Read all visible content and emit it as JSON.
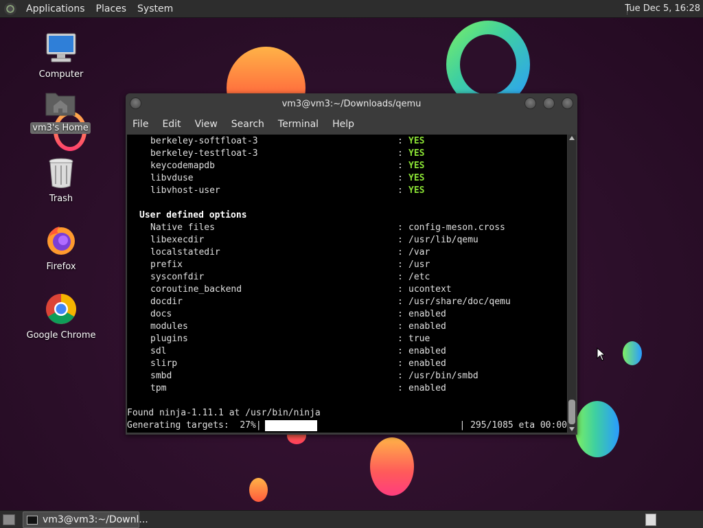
{
  "top_panel": {
    "menus": [
      "Applications",
      "Places",
      "System"
    ],
    "clock": "Tue Dec  5, 16:28"
  },
  "desktop_icons": [
    {
      "label": "Computer",
      "icon": "computer-icon"
    },
    {
      "label": "vm3's Home",
      "icon": "home-folder-icon",
      "selected": true
    },
    {
      "label": "Trash",
      "icon": "trash-icon"
    },
    {
      "label": "Firefox",
      "icon": "firefox-icon"
    },
    {
      "label": "Google Chrome",
      "icon": "chrome-icon"
    }
  ],
  "terminal": {
    "title": "vm3@vm3:~/Downloads/qemu",
    "menus": [
      "File",
      "Edit",
      "View",
      "Search",
      "Terminal",
      "Help"
    ],
    "lines": [
      {
        "key": "berkeley-softfloat-3",
        "value": "YES",
        "yes": true
      },
      {
        "key": "berkeley-testfloat-3",
        "value": "YES",
        "yes": true
      },
      {
        "key": "keycodemapdb",
        "value": "YES",
        "yes": true
      },
      {
        "key": "libvduse",
        "value": "YES",
        "yes": true
      },
      {
        "key": "libvhost-user",
        "value": "YES",
        "yes": true
      },
      {
        "blank": true
      },
      {
        "section": "User defined options"
      },
      {
        "key": "Native files",
        "value": "config-meson.cross"
      },
      {
        "key": "libexecdir",
        "value": "/usr/lib/qemu"
      },
      {
        "key": "localstatedir",
        "value": "/var"
      },
      {
        "key": "prefix",
        "value": "/usr"
      },
      {
        "key": "sysconfdir",
        "value": "/etc"
      },
      {
        "key": "coroutine_backend",
        "value": "ucontext"
      },
      {
        "key": "docdir",
        "value": "/usr/share/doc/qemu"
      },
      {
        "key": "docs",
        "value": "enabled"
      },
      {
        "key": "modules",
        "value": "enabled"
      },
      {
        "key": "plugins",
        "value": "true"
      },
      {
        "key": "sdl",
        "value": "enabled"
      },
      {
        "key": "slirp",
        "value": "enabled"
      },
      {
        "key": "smbd",
        "value": "/usr/bin/smbd"
      },
      {
        "key": "tpm",
        "value": "enabled"
      },
      {
        "blank": true
      },
      {
        "raw": "Found ninja-1.11.1 at /usr/bin/ninja"
      }
    ],
    "progress": {
      "label": "Generating targets:  27%|",
      "percent": 27,
      "suffix": "| 295/1085 eta 00:00"
    }
  },
  "taskbar": {
    "task_label": "vm3@vm3:~/Downl..."
  }
}
